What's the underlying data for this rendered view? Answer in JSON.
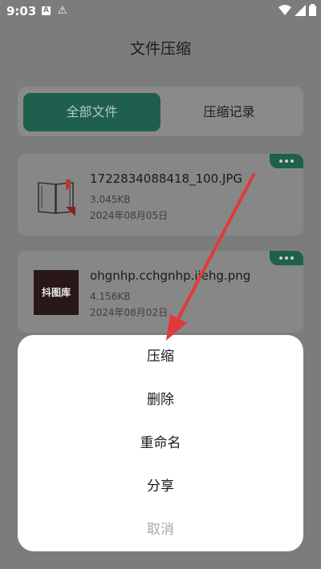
{
  "status_bar": {
    "time": "9:03",
    "a_icon_letter": "A"
  },
  "page": {
    "title": "文件压缩"
  },
  "tabs": [
    {
      "label": "全部文件",
      "active": true
    },
    {
      "label": "压缩记录",
      "active": false
    }
  ],
  "files": [
    {
      "name": "1722834088418_100.JPG",
      "size": "3.045KB",
      "date": "2024年08月05日",
      "thumb_icon": "book-icon"
    },
    {
      "name": "ohgnhp.cchgnhp.iiehg.png",
      "size": "4.156KB",
      "date": "2024年08月02日",
      "thumb_text": "抖图库"
    }
  ],
  "action_sheet": {
    "items": [
      {
        "label": "压缩"
      },
      {
        "label": "删除"
      },
      {
        "label": "重命名"
      },
      {
        "label": "分享"
      },
      {
        "label": "取消"
      }
    ]
  },
  "colors": {
    "accent": "#1e5f4e",
    "overlay_bg": "#7c7c7c",
    "sheet_bg": "#ffffff",
    "arrow": "#e03a3a"
  }
}
